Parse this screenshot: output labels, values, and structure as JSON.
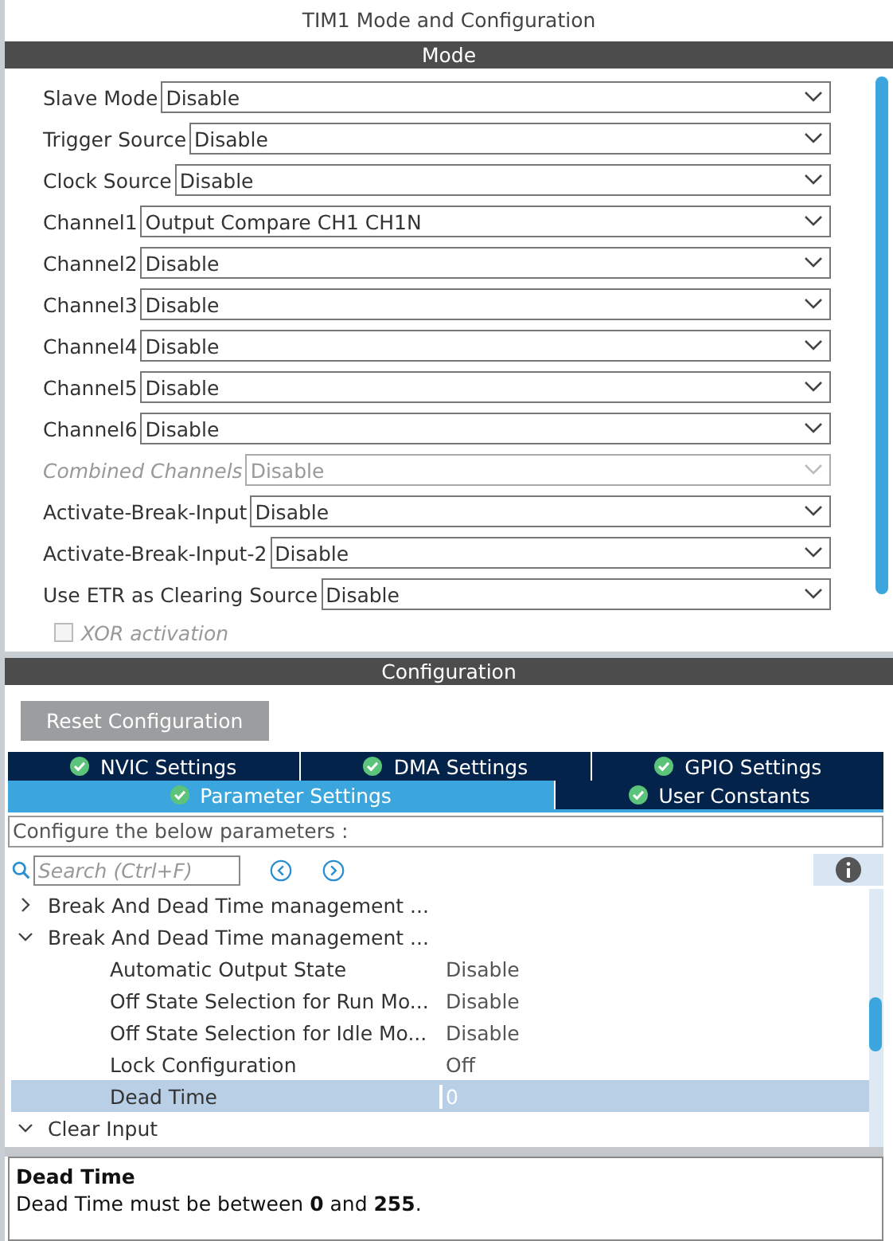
{
  "window": {
    "title": "TIM1 Mode and Configuration"
  },
  "mode": {
    "header": "Mode",
    "rows": [
      {
        "kind": "select",
        "label": "Slave Mode",
        "value": "Disable",
        "disabled": false
      },
      {
        "kind": "select",
        "label": "Trigger Source",
        "value": "Disable",
        "disabled": false
      },
      {
        "kind": "select",
        "label": "Clock Source",
        "value": "Disable",
        "disabled": false
      },
      {
        "kind": "select",
        "label": "Channel1",
        "value": "Output Compare CH1 CH1N",
        "disabled": false
      },
      {
        "kind": "select",
        "label": "Channel2",
        "value": "Disable",
        "disabled": false
      },
      {
        "kind": "select",
        "label": "Channel3",
        "value": "Disable",
        "disabled": false
      },
      {
        "kind": "select",
        "label": "Channel4",
        "value": "Disable",
        "disabled": false
      },
      {
        "kind": "select",
        "label": "Channel5",
        "value": "Disable",
        "disabled": false
      },
      {
        "kind": "select",
        "label": "Channel6",
        "value": "Disable",
        "disabled": false
      },
      {
        "kind": "select",
        "label": "Combined Channels",
        "value": "Disable",
        "disabled": true
      },
      {
        "kind": "select",
        "label": "Activate-Break-Input",
        "value": "Disable",
        "disabled": false
      },
      {
        "kind": "select",
        "label": "Activate-Break-Input-2",
        "value": "Disable",
        "disabled": false
      },
      {
        "kind": "select",
        "label": "Use ETR as Clearing Source",
        "value": "Disable",
        "disabled": false
      },
      {
        "kind": "checkbox",
        "label": "XOR activation",
        "checked": false,
        "disabled": true
      }
    ]
  },
  "configuration": {
    "header": "Configuration",
    "reset_button": "Reset Configuration",
    "tabs": [
      {
        "label": "NVIC Settings",
        "selected": false
      },
      {
        "label": "DMA Settings",
        "selected": false
      },
      {
        "label": "GPIO Settings",
        "selected": false
      },
      {
        "label": "Parameter Settings",
        "selected": true
      },
      {
        "label": "User Constants",
        "selected": false
      }
    ],
    "hint": "Configure the below parameters :",
    "search": {
      "placeholder": "Search (Ctrl+F)"
    },
    "tree": [
      {
        "label": "Break And Dead Time management ...",
        "expanded": false
      },
      {
        "label": "Break And Dead Time management ...",
        "expanded": true,
        "children": [
          {
            "name": "Automatic Output State",
            "value": "Disable",
            "selected": false
          },
          {
            "name": "Off State Selection for Run Mo...",
            "value": "Disable",
            "selected": false
          },
          {
            "name": "Off State Selection for Idle Mo...",
            "value": "Disable",
            "selected": false
          },
          {
            "name": "Lock Configuration",
            "value": "Off",
            "selected": false
          },
          {
            "name": "Dead Time",
            "value": "0",
            "selected": true
          }
        ]
      },
      {
        "label": "Clear Input",
        "expanded": true
      }
    ],
    "description": {
      "title": "Dead Time",
      "text": "Dead Time must be between **0** and **255**."
    }
  }
}
